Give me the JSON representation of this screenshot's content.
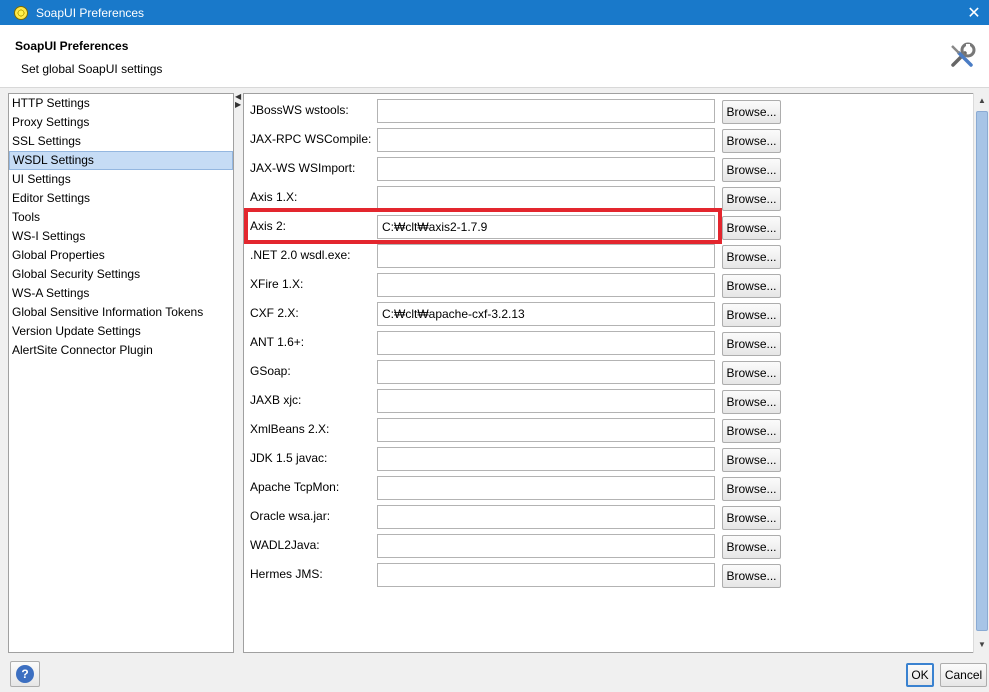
{
  "window": {
    "title": "SoapUI Preferences",
    "close_glyph": "✕"
  },
  "header": {
    "title": "SoapUI Preferences",
    "subtitle": "Set global SoapUI settings",
    "icon": "tools-icon"
  },
  "nav": {
    "selected": "WSDL Settings",
    "items": [
      "HTTP Settings",
      "Proxy Settings",
      "SSL Settings",
      "WSDL Settings",
      "UI Settings",
      "Editor Settings",
      "Tools",
      "WS-I Settings",
      "Global Properties",
      "Global Security Settings",
      "WS-A Settings",
      "Global Sensitive Information Tokens",
      "Version Update Settings",
      "AlertSite Connector Plugin"
    ]
  },
  "tools": {
    "browse_label": "Browse...",
    "highlighted_row": "Axis 2:",
    "highlight_color": "#e3262e",
    "rows": [
      {
        "label": "JBossWS wstools:",
        "value": ""
      },
      {
        "label": "JAX-RPC WSCompile:",
        "value": ""
      },
      {
        "label": "JAX-WS WSImport:",
        "value": ""
      },
      {
        "label": "Axis 1.X:",
        "value": ""
      },
      {
        "label": "Axis 2:",
        "value": "C:₩clt₩axis2-1.7.9"
      },
      {
        "label": ".NET 2.0 wsdl.exe:",
        "value": ""
      },
      {
        "label": "XFire 1.X:",
        "value": ""
      },
      {
        "label": "CXF 2.X:",
        "value": "C:₩clt₩apache-cxf-3.2.13"
      },
      {
        "label": "ANT 1.6+:",
        "value": ""
      },
      {
        "label": "GSoap:",
        "value": ""
      },
      {
        "label": "JAXB xjc:",
        "value": ""
      },
      {
        "label": "XmlBeans 2.X:",
        "value": ""
      },
      {
        "label": "JDK 1.5 javac:",
        "value": ""
      },
      {
        "label": "Apache TcpMon:",
        "value": ""
      },
      {
        "label": "Oracle wsa.jar:",
        "value": ""
      },
      {
        "label": "WADL2Java:",
        "value": ""
      },
      {
        "label": "Hermes JMS:",
        "value": ""
      }
    ]
  },
  "footer": {
    "help_glyph": "?",
    "ok_label": "OK",
    "cancel_label": "Cancel"
  }
}
